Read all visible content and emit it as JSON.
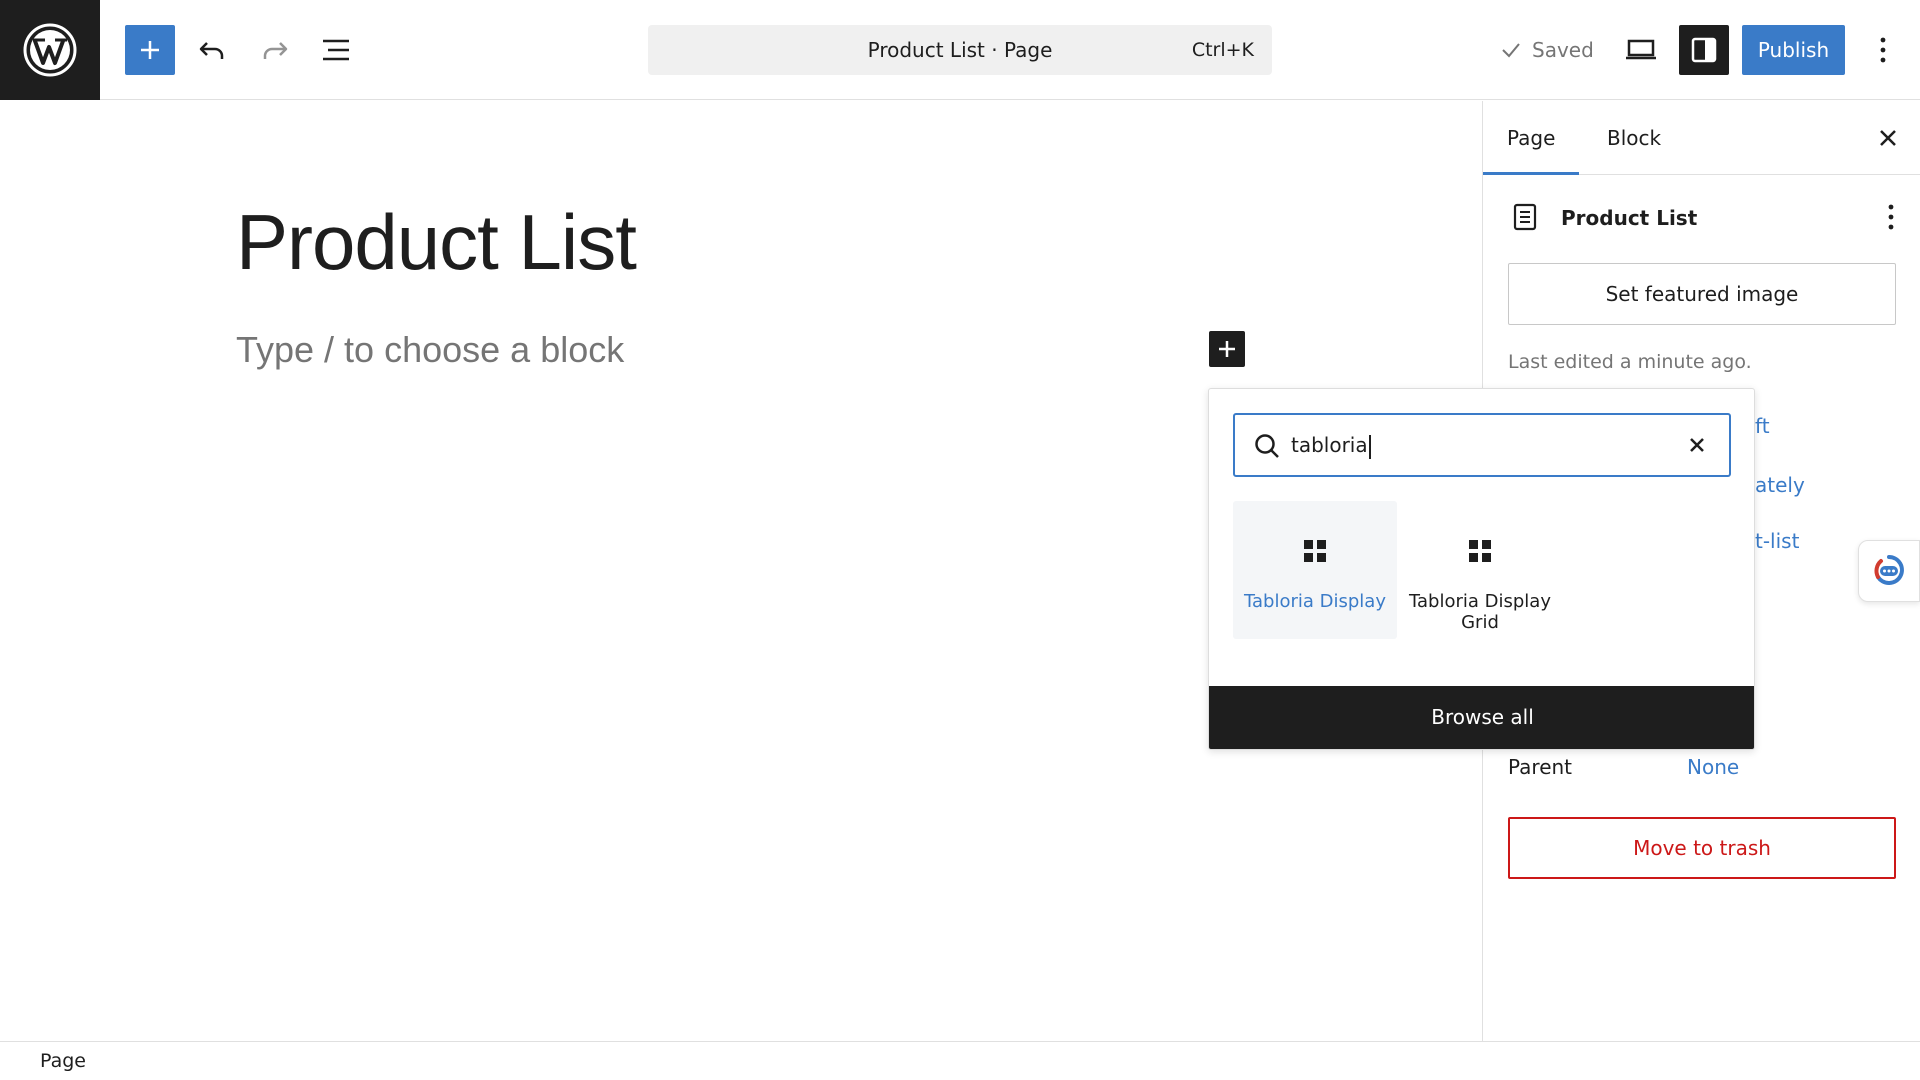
{
  "toolbar": {
    "document_title": "Product List · Page",
    "shortcut": "Ctrl+K",
    "saved_label": "Saved",
    "publish_label": "Publish"
  },
  "editor": {
    "title": "Product List",
    "placeholder": "Type / to choose a block"
  },
  "inserter": {
    "search_value": "tabloria",
    "results": [
      {
        "label": "Tabloria Display",
        "icon": "grid-icon",
        "highlighted": true
      },
      {
        "label": "Tabloria Display Grid",
        "icon": "grid-icon",
        "highlighted": false
      }
    ],
    "browse_all_label": "Browse all"
  },
  "sidebar": {
    "tabs": [
      {
        "label": "Page",
        "active": true
      },
      {
        "label": "Block",
        "active": false
      }
    ],
    "document": {
      "title": "Product List",
      "featured_image_label": "Set featured image",
      "last_edited": "Last edited a minute ago.",
      "partial_links": [
        "ft",
        "ately",
        "t-list"
      ],
      "parent_label": "Parent",
      "parent_value": "None",
      "trash_label": "Move to trash"
    }
  },
  "statusbar": {
    "breadcrumb": "Page"
  },
  "colors": {
    "accent": "#3a7bc8",
    "dark": "#1e1e1e",
    "danger": "#cc1818",
    "muted": "#757575"
  }
}
